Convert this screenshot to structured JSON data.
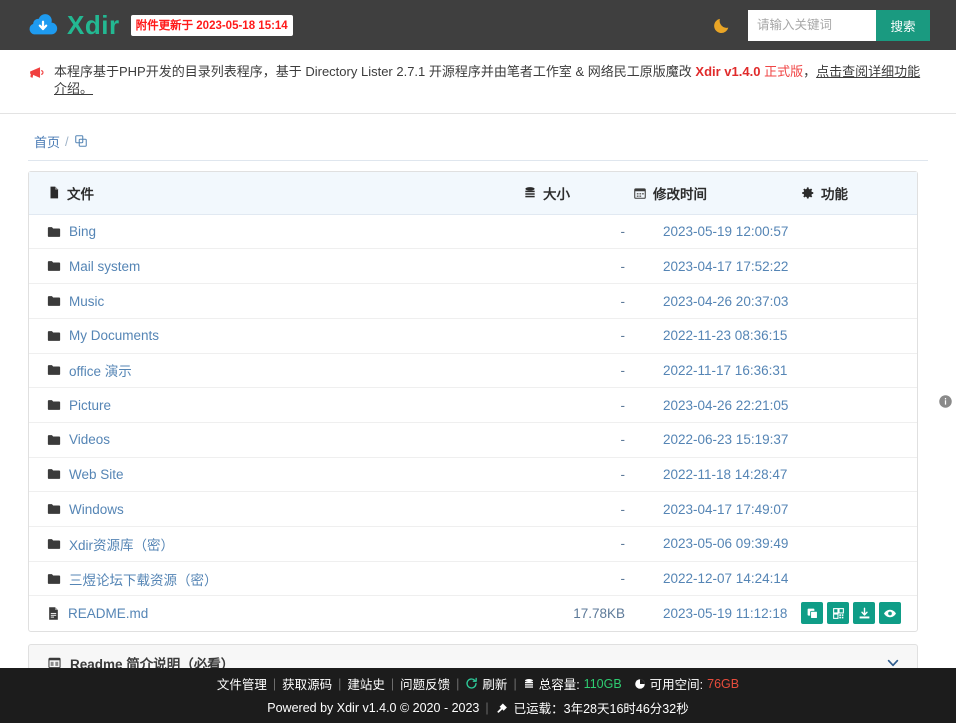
{
  "header": {
    "brand": "Xdir",
    "logo_icon": "cloud-download-icon",
    "update_badge": "附件更新于 2023-05-18 15:14",
    "theme_toggle_icon": "moon-icon",
    "search_placeholder": "请输入关键词",
    "search_value": "",
    "search_button": "搜索",
    "brand_color": "#23b892",
    "logo_color": "#1e9bf0",
    "search_btn_color": "#1a9a80"
  },
  "notice": {
    "icon": "megaphone-icon",
    "text_part1": "本程序基于PHP开发的目录列表程序，基于 Directory Lister 2.7.1 开源程序并由笔者工作室 & 网络民工原版魔改 ",
    "version": "Xdir v1.4.0",
    "version_tag": "正式版",
    "text_part2": "，",
    "link_text": "点击查阅详细功能介绍。"
  },
  "breadcrumb": {
    "home": "首页",
    "separator": "/",
    "copy_icon": "copy-path-icon"
  },
  "table": {
    "headers": {
      "file": "文件",
      "file_icon": "file-icon",
      "size": "大小",
      "size_icon": "database-icon",
      "date": "修改时间",
      "date_icon": "calendar-icon",
      "actions": "功能",
      "actions_icon": "gear-icon"
    },
    "rows": [
      {
        "icon": "folder-icon",
        "name": "Bing",
        "size": "-",
        "date": "2023-05-19 12:00:57",
        "actions": []
      },
      {
        "icon": "folder-icon",
        "name": "Mail system",
        "size": "-",
        "date": "2023-04-17 17:52:22",
        "actions": []
      },
      {
        "icon": "folder-icon",
        "name": "Music",
        "size": "-",
        "date": "2023-04-26 20:37:03",
        "actions": []
      },
      {
        "icon": "folder-icon",
        "name": "My Documents",
        "size": "-",
        "date": "2022-11-23 08:36:15",
        "actions": []
      },
      {
        "icon": "folder-icon",
        "name": "office 演示",
        "size": "-",
        "date": "2022-11-17 16:36:31",
        "actions": []
      },
      {
        "icon": "folder-icon",
        "name": "Picture",
        "size": "-",
        "date": "2023-04-26 22:21:05",
        "actions": []
      },
      {
        "icon": "folder-icon",
        "name": "Videos",
        "size": "-",
        "date": "2022-06-23 15:19:37",
        "actions": []
      },
      {
        "icon": "folder-icon",
        "name": "Web Site",
        "size": "-",
        "date": "2022-11-18 14:28:47",
        "actions": []
      },
      {
        "icon": "folder-icon",
        "name": "Windows",
        "size": "-",
        "date": "2023-04-17 17:49:07",
        "actions": []
      },
      {
        "icon": "folder-icon",
        "name": "Xdir资源库（密）",
        "size": "-",
        "date": "2023-05-06 09:39:49",
        "actions": []
      },
      {
        "icon": "folder-icon",
        "name": "三煜论坛下载资源（密）",
        "size": "-",
        "date": "2022-12-07 14:24:14",
        "actions": []
      },
      {
        "icon": "markdown-file-icon",
        "name": "README.md",
        "size": "17.78KB",
        "date": "2023-05-19 11:12:18",
        "actions": [
          "copy-link-icon",
          "qrcode-icon",
          "download-icon",
          "preview-eye-icon"
        ]
      }
    ],
    "info_icon": "info-icon"
  },
  "readme_panel": {
    "icon": "readme-window-icon",
    "title": "Readme 简介说明（必看）",
    "chevron": "chevron-down-icon"
  },
  "footer": {
    "links": [
      "文件管理",
      "获取源码",
      "建站史",
      "问题反馈"
    ],
    "refresh_icon": "refresh-icon",
    "refresh": "刷新",
    "total_icon": "database-icon",
    "total_label": "总容量:",
    "total_value": "110GB",
    "free_icon": "pie-chart-icon",
    "free_label": "可用空间:",
    "free_value": "76GB",
    "powered": "Powered by Xdir v1.4.0  © 2020 - 2023",
    "uptime_icon": "plug-icon",
    "uptime": "已运载：3年28天16时46分32秒"
  }
}
